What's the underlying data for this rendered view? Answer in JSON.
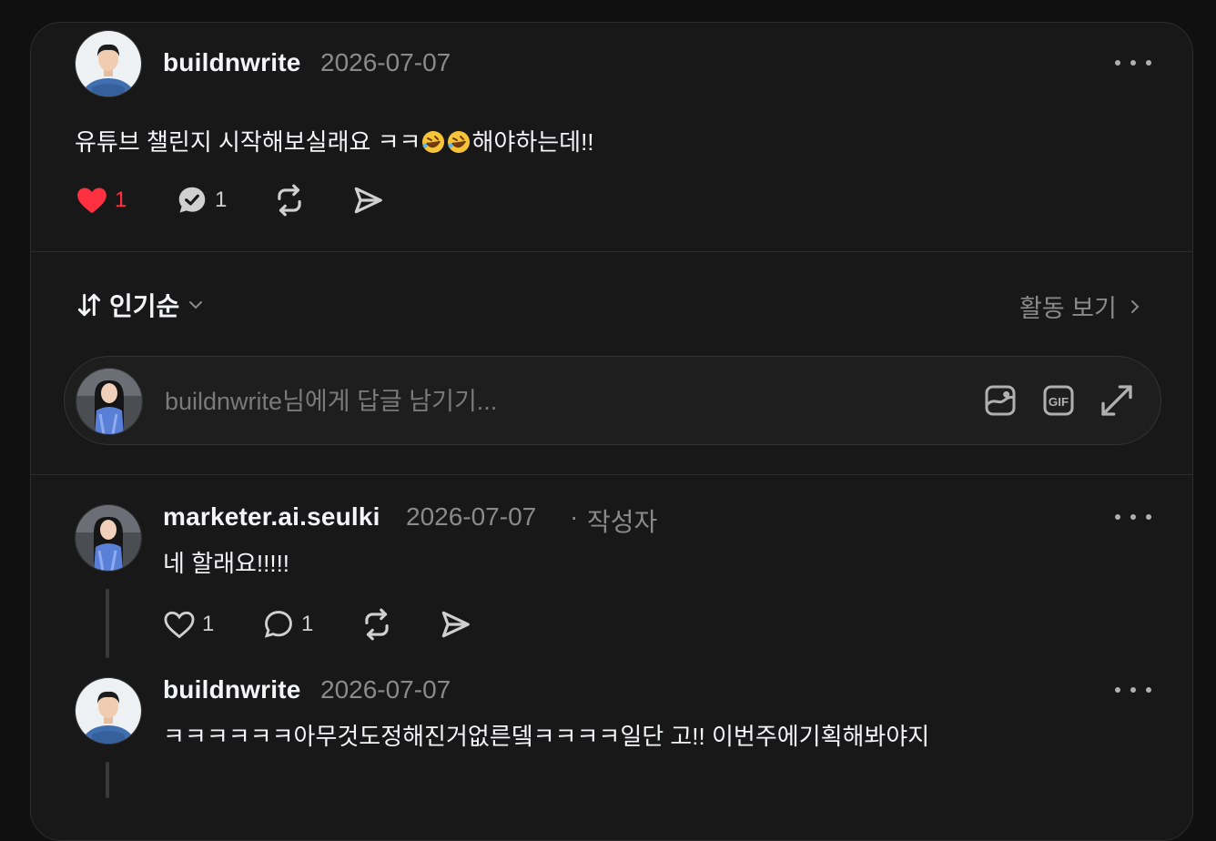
{
  "post": {
    "username": "buildnwrite",
    "date": "2026-07-07",
    "text_before": "유튜브 챌린지 시작해보실래요 ㅋㅋ",
    "emoji_1": "🤣",
    "emoji_2": "🤣",
    "text_after": "해야하는데!!",
    "like_count": "1",
    "comment_count": "1",
    "liked": true
  },
  "sort": {
    "label": "인기순",
    "activity_label": "활동 보기"
  },
  "reply_box": {
    "placeholder": "buildnwrite님에게 답글 남기기..."
  },
  "comments": [
    {
      "username": "marketer.ai.seulki",
      "date": "2026-07-07",
      "separator": "·",
      "author_tag": "작성자",
      "text": "네 할래요!!!!!",
      "like_count": "1",
      "comment_count": "1"
    },
    {
      "username": "buildnwrite",
      "date": "2026-07-07",
      "text": "ㅋㅋㅋㅋㅋㅋ아무것도정해진거없른뎈ㅋㅋㅋㅋ일단 고!! 이번주에기획해봐야지"
    }
  ],
  "colors": {
    "background": "#101010",
    "card": "#181818",
    "like_active": "#ff3040",
    "muted_text": "#8a8a8a"
  },
  "icons": [
    "heart-icon",
    "comment-icon",
    "repost-icon",
    "share-icon",
    "sort-icon",
    "chevron-down-icon",
    "chevron-right-icon",
    "image-icon",
    "gif-icon",
    "expand-icon",
    "more-icon"
  ]
}
